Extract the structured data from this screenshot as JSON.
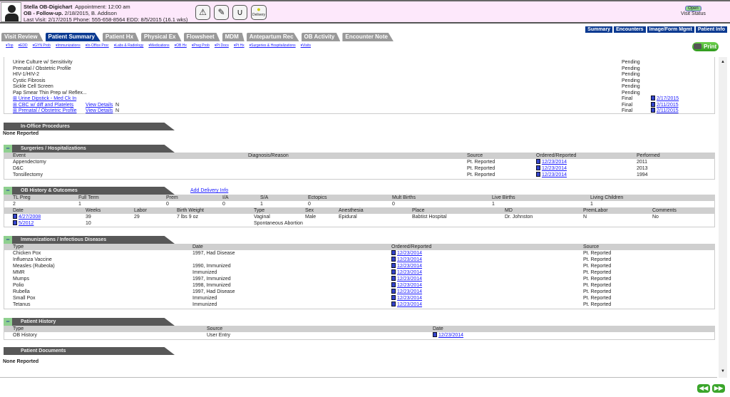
{
  "header": {
    "patient_name": "Stella OB-Digichart",
    "appointment": "Appointment: 12:00 am",
    "visit_type": "OB - Follow-up.",
    "visit_info": "2/18/2015, B. Addison",
    "last_visit": "Last Visit: 2/17/2015  Phone: 555-658-8564  EDD: 8/5/2015 (16.1 wks)",
    "delivery_label": "Delivery",
    "visit_status_badge": "Open",
    "visit_status_label": "Visit Status"
  },
  "right_nav": [
    "Summary",
    "Encounters",
    "Image/Form Mgmt",
    "Patient Info"
  ],
  "tabs": [
    "Visit Review",
    "Patient Summary",
    "Patient Hx",
    "Physical Ex",
    "Flowsheet",
    "MDM",
    "Antepartum Rec",
    "OB Activity",
    "Encounter Note"
  ],
  "active_tab": "Patient Summary",
  "anchors": [
    "Top",
    "EDD",
    "GYN Prob",
    "Immunizations",
    "In-Office Proc",
    "Labs & Radiology",
    "Medications",
    "OB Hx",
    "Preg Prob",
    "Pt Docs",
    "Pt Hx",
    "Surgeries & Hospitalizations",
    "Visits"
  ],
  "print_label": "Print",
  "labs": [
    {
      "name": "Urine Culture w/ Sensitivity",
      "status": "Pending"
    },
    {
      "name": "Prenatal / Obstetric Profile",
      "status": "Pending"
    },
    {
      "name": "HIV-1/HIV-2",
      "status": "Pending"
    },
    {
      "name": "Cystic Fibrosis",
      "status": "Pending"
    },
    {
      "name": "Sickle Cell Screen",
      "status": "Pending"
    },
    {
      "name": "Pap Smear Thin Prep w/ Reflex...",
      "status": "Pending"
    },
    {
      "name": "Urine Dipstick - Med Ck In",
      "status": "Final",
      "date": "2/17/2015",
      "link": true
    },
    {
      "name": "CBC w/ diff and Platelets",
      "details": "View Details",
      "flag": "N",
      "status": "Final",
      "date": "2/11/2015",
      "link": true
    },
    {
      "name": "Prenatal / Obstetric Profile",
      "details": "View Details",
      "flag": "N",
      "status": "Final",
      "date": "2/11/2015",
      "link": true
    }
  ],
  "in_office": {
    "title": "In-Office Procedures",
    "empty": "None Reported"
  },
  "surgeries": {
    "title": "Surgeries / Hospitalizations",
    "columns": [
      "Event",
      "Diagnosis/Reason",
      "Source",
      "Ordered/Reported",
      "Performed"
    ],
    "rows": [
      [
        "Appendectomy",
        "",
        "Pt. Reported",
        "12/23/2014",
        "2011"
      ],
      [
        "D&C",
        "",
        "Pt. Reported",
        "12/23/2014",
        "2013"
      ],
      [
        "Tonsillectomy",
        "",
        "Pt. Reported",
        "12/23/2014",
        "1994"
      ]
    ]
  },
  "ob_history": {
    "title": "OB History & Outcomes",
    "add_link": "Add Delivery Info",
    "summary_columns": [
      "TL Preg",
      "Full Term",
      "Prem",
      "I/A",
      "S/A",
      "Ectopics",
      "Mult Births",
      "Live Births",
      "Living Children"
    ],
    "summary_values": [
      "2",
      "1",
      "0",
      "0",
      "1",
      "0",
      "0",
      "1",
      "1"
    ],
    "columns": [
      "Date",
      "Weeks",
      "Labor",
      "Birth Weight",
      "Type",
      "Sex",
      "Anesthesia",
      "Place",
      "MD",
      "PremLabor",
      "Comments"
    ],
    "rows": [
      [
        "4/27/2008",
        "39",
        "29",
        "7 lbs 9 oz",
        "Vaginal",
        "Male",
        "Epidural",
        "Babtist Hospital",
        "Dr. Johnston",
        "N",
        "No"
      ],
      [
        "5/2012",
        "10",
        "",
        "",
        "Spontaneous Abortion",
        "",
        "",
        "",
        "",
        "",
        ""
      ]
    ]
  },
  "immunizations": {
    "title": "Immunizations / Infectious Diseases",
    "columns": [
      "Type",
      "Date",
      "Ordered/Reported",
      "Source"
    ],
    "rows": [
      [
        "Chicken Pox",
        "1997, Had Disease",
        "12/23/2014",
        "Pt. Reported"
      ],
      [
        "Influenza Vaccine",
        "",
        "12/23/2014",
        "Pt. Reported"
      ],
      [
        "Measles (Rubeola)",
        "1990, Immunized",
        "12/23/2014",
        "Pt. Reported"
      ],
      [
        "MMR",
        "Immunized",
        "12/23/2014",
        "Pt. Reported"
      ],
      [
        "Mumps",
        "1997, Immunized",
        "12/23/2014",
        "Pt. Reported"
      ],
      [
        "Polio",
        "1998, Immunized",
        "12/23/2014",
        "Pt. Reported"
      ],
      [
        "Rubella",
        "1997, Had Disease",
        "12/23/2014",
        "Pt. Reported"
      ],
      [
        "Small Pox",
        "Immunized",
        "12/23/2014",
        "Pt. Reported"
      ],
      [
        "Tetanus",
        "Immunized",
        "12/23/2014",
        "Pt. Reported"
      ]
    ]
  },
  "patient_history": {
    "title": "Patient History",
    "columns": [
      "Type",
      "Source",
      "Date"
    ],
    "rows": [
      [
        "OB History",
        "User Entry",
        "12/23/2014"
      ]
    ]
  },
  "patient_documents": {
    "title": "Patient Documents",
    "empty": "None Reported"
  }
}
